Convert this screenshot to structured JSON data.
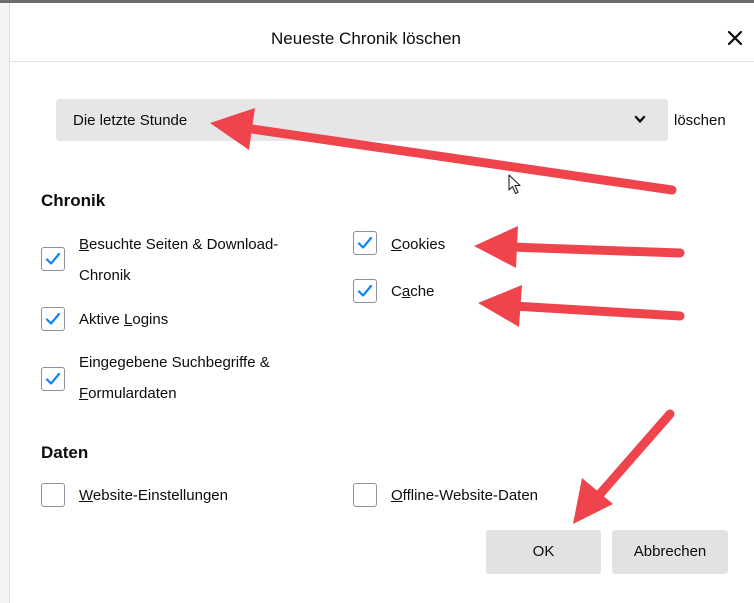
{
  "dialog": {
    "title": "Neueste Chronik löschen"
  },
  "timerange": {
    "selected": "Die letzte Stunde",
    "suffix": "löschen"
  },
  "history": {
    "heading": "Chronik",
    "items": [
      {
        "line1_prefix": "",
        "line1_key": "B",
        "line1_rest": "esuchte Seiten & Download-",
        "line2_prefix": "",
        "line2_key": "",
        "line2_rest": "Chronik",
        "checked": true
      },
      {
        "line1_prefix": "Aktive ",
        "line1_key": "L",
        "line1_rest": "ogins",
        "checked": true
      },
      {
        "line1_prefix": "",
        "line1_key": "",
        "line1_rest": "Eingegebene Suchbegriffe &",
        "line2_prefix": "",
        "line2_key": "F",
        "line2_rest": "ormulardaten",
        "checked": true
      },
      {
        "line1_prefix": "",
        "line1_key": "C",
        "line1_rest": "ookies",
        "checked": true
      },
      {
        "line1_prefix": "C",
        "line1_key": "a",
        "line1_rest": "che",
        "checked": true
      }
    ]
  },
  "data": {
    "heading": "Daten",
    "items": [
      {
        "line1_prefix": "",
        "line1_key": "W",
        "line1_rest": "ebsite-Einstellungen",
        "checked": false
      },
      {
        "line1_prefix": "",
        "line1_key": "O",
        "line1_rest": "ffline-Website-Daten",
        "checked": false
      }
    ]
  },
  "buttons": {
    "ok": "OK",
    "cancel": "Abbrechen"
  },
  "colors": {
    "accent": "#0a84ff",
    "annotation_arrow": "#f0444c",
    "button_bg": "#e2e2e4"
  },
  "icons": {
    "close": "close-icon",
    "dropdown": "chevron-down-icon",
    "check": "checkmark-icon",
    "pointer": "mouse-cursor-icon"
  }
}
